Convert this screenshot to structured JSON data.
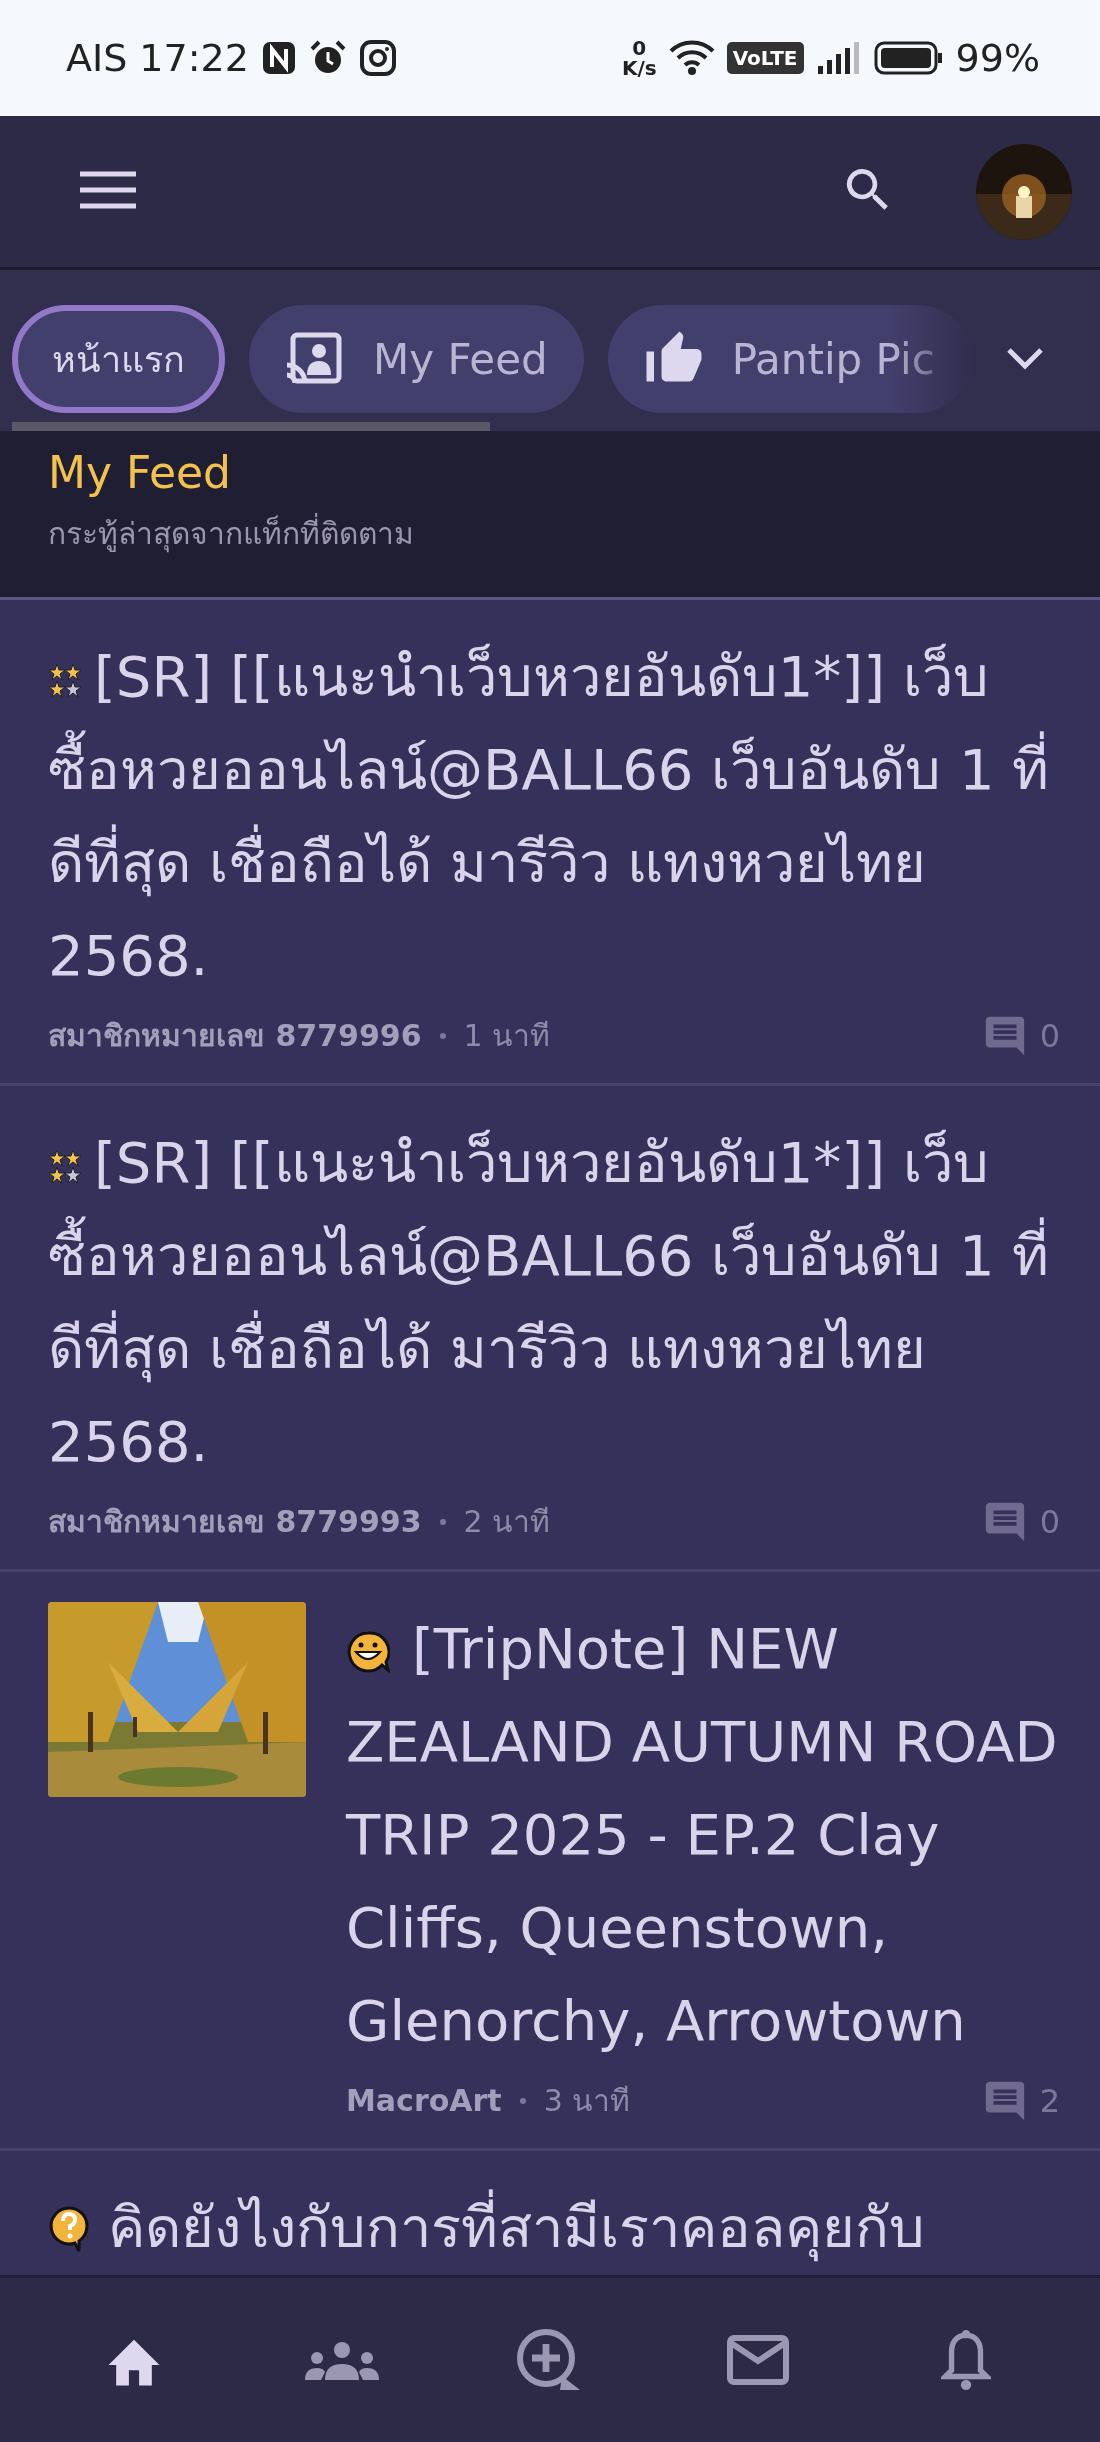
{
  "status_bar": {
    "carrier": "AIS",
    "time": "17:22",
    "speed_value": "0",
    "speed_unit": "K/s",
    "volte": "VoLTE",
    "battery": "99%"
  },
  "tabs": [
    {
      "label": "หน้าแรก",
      "kind": "plain",
      "selected": true
    },
    {
      "label": "My Feed",
      "kind": "feed",
      "selected": false
    },
    {
      "label": "Pantip Pic",
      "kind": "like",
      "selected": false
    }
  ],
  "section": {
    "title": "My Feed",
    "subtitle": "กระทู้ล่าสุดจากแท็กที่ติดตาม"
  },
  "posts": [
    {
      "kind": "text",
      "badge": {
        "kind": "stars"
      },
      "title": "[SR] [[แนะนำเว็บหวยอันดับ1*]] เว็บซื้อหวยออนไลน์@BALL66 เว็บอันดับ 1 ที่ดีที่สุด เชื่อถือได้ มารีวิว แทงหวยไทย 2568.",
      "author": "สมาชิกหมายเลข 8779996",
      "time": "1 นาที",
      "comments": "0"
    },
    {
      "kind": "text",
      "badge": {
        "kind": "stars"
      },
      "title": "[SR] [[แนะนำเว็บหวยอันดับ1*]] เว็บซื้อหวยออนไลน์@BALL66 เว็บอันดับ 1 ที่ดีที่สุด เชื่อถือได้ มารีวิว แทงหวยไทย 2568.",
      "author": "สมาชิกหมายเลข 8779993",
      "time": "2 นาที",
      "comments": "0"
    },
    {
      "kind": "thumb",
      "badge": {
        "kind": "smile"
      },
      "title": "[TripNote] NEW ZEALAND AUTUMN ROAD TRIP 2025 - EP.2 Clay Cliffs, Queenstown, Glenorchy, Arrowtown",
      "author": "MacroArt",
      "time": "3 นาที",
      "comments": "2"
    },
    {
      "kind": "cut",
      "badge": {
        "kind": "question"
      },
      "title": "คิดยังไงกับการที่สามีเราคอลคุยกับ"
    }
  ],
  "nav": [
    {
      "kind": "home",
      "selected": true
    },
    {
      "kind": "people",
      "selected": false
    },
    {
      "kind": "add",
      "selected": false
    },
    {
      "kind": "mail",
      "selected": false
    },
    {
      "kind": "bell",
      "selected": false
    }
  ]
}
